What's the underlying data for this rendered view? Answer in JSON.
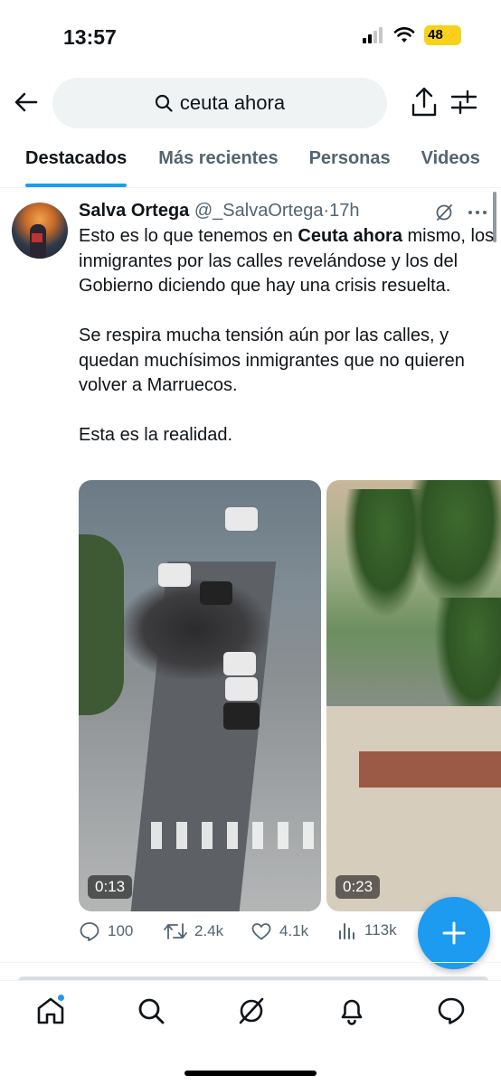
{
  "status_bar": {
    "time": "13:57",
    "battery": "48",
    "icons": [
      "cellular-signal-icon",
      "wifi-icon",
      "battery-icon"
    ]
  },
  "search": {
    "query": "ceuta ahora",
    "icons": [
      "back-arrow-icon",
      "search-icon",
      "share-icon",
      "filter-icon"
    ]
  },
  "tabs": [
    {
      "label": "Destacados",
      "active": true
    },
    {
      "label": "Más recientes",
      "active": false
    },
    {
      "label": "Personas",
      "active": false
    },
    {
      "label": "Videos",
      "active": false
    }
  ],
  "tweet": {
    "display_name": "Salva Ortega",
    "handle": "@_SalvaOrtega",
    "separator": "·",
    "time": "17h",
    "text_p1_before": "Esto es lo que tenemos en ",
    "text_p1_bold": "Ceuta ahora",
    "text_p1_after": " mismo, los inmigrantes por las calles revelándose y los del Gobierno diciendo que hay una crisis resuelta.",
    "text_p2": "Se respira mucha tensión aún por las calles, y quedan muchísimos inmigrantes que no quieren volver a Marruecos.",
    "text_p3": "Esta es la realidad.",
    "media": [
      {
        "duration": "0:13"
      },
      {
        "duration": "0:23"
      }
    ],
    "stats": {
      "replies": "100",
      "reposts": "2.4k",
      "likes": "4.1k",
      "views": "113k"
    }
  },
  "colors": {
    "accent": "#1d9bf0",
    "text": "#0f1419",
    "muted": "#536471",
    "search_bg": "#eff3f4"
  },
  "bottom_nav": [
    "home-icon",
    "search-icon",
    "grok-icon",
    "notifications-icon",
    "messages-icon"
  ]
}
